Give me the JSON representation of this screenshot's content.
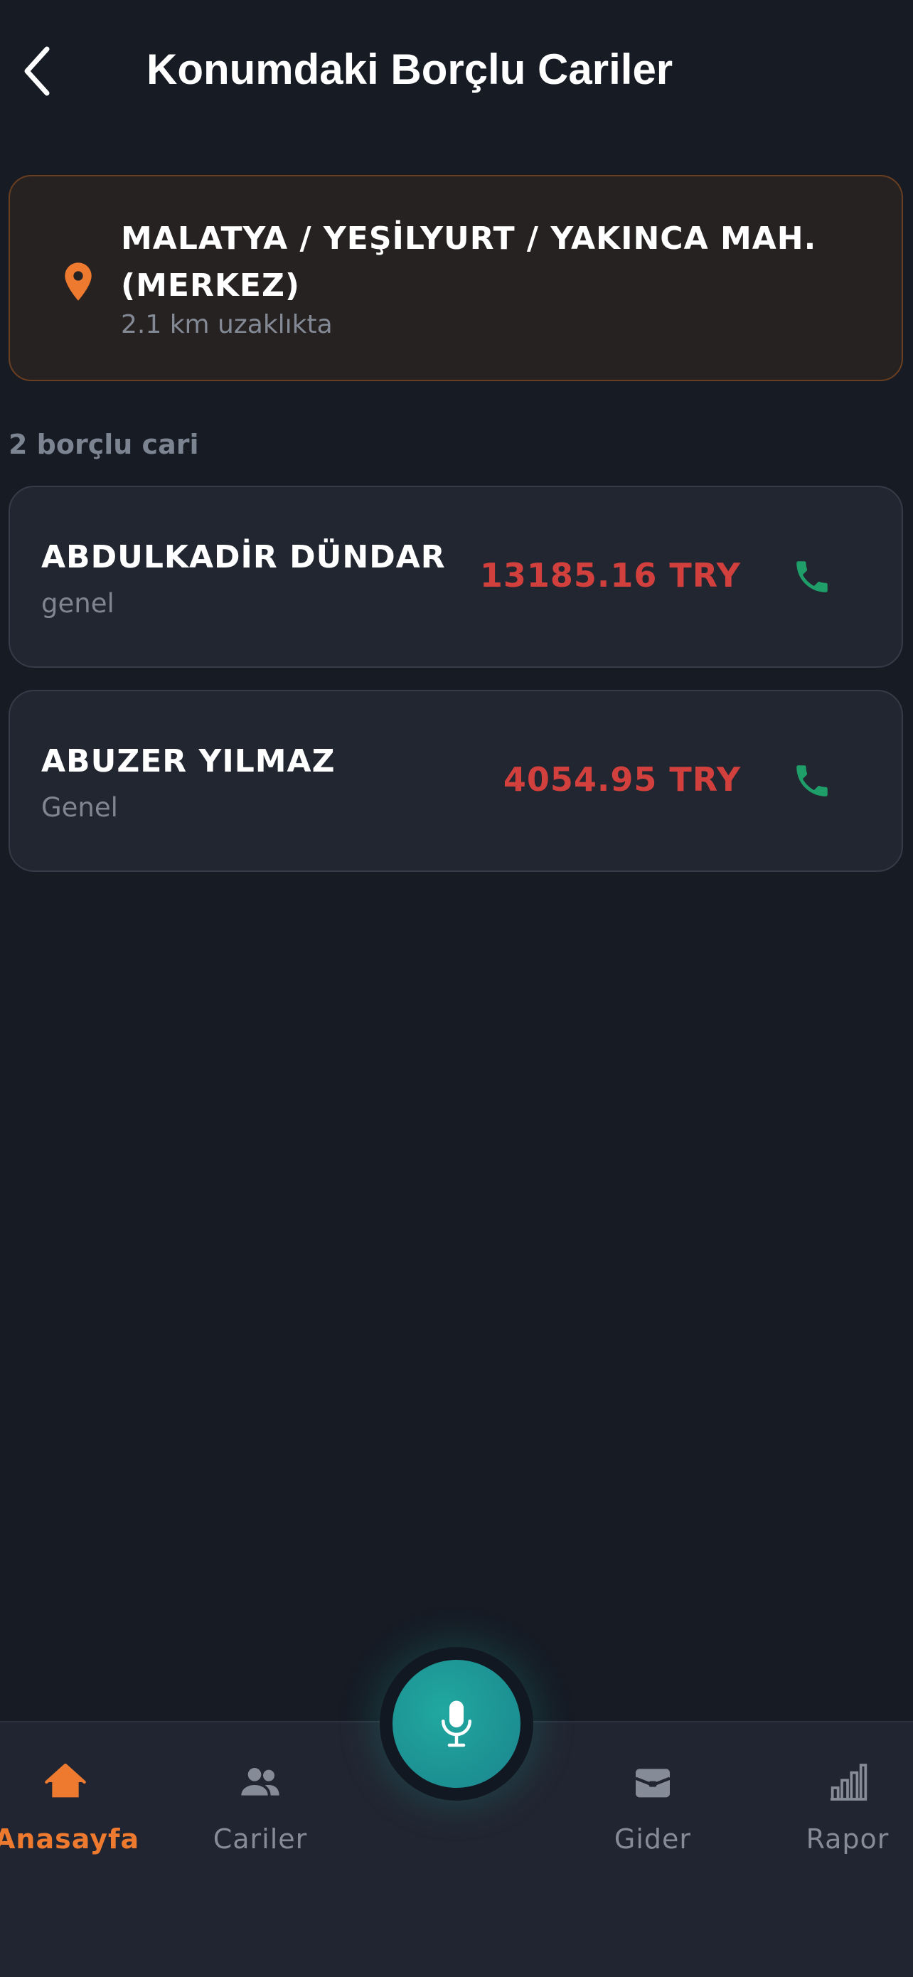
{
  "header": {
    "title": "Konumdaki Borçlu Cariler",
    "back_icon": "chevron-left-icon"
  },
  "location": {
    "icon": "map-pin-icon",
    "title": "MALATYA / YEŞİLYURT / YAKINCA MAH. (MERKEZ)",
    "distance": "2.1 km uzaklıkta",
    "accent_color": "#ee7a2f"
  },
  "list": {
    "count_label": "2 borçlu cari",
    "debtors": [
      {
        "name": "ABDULKADİR DÜNDAR",
        "group": "genel",
        "amount": "13185.16 TRY"
      },
      {
        "name": "ABUZER YILMAZ",
        "group": "Genel",
        "amount": "4054.95 TRY"
      }
    ],
    "amount_color": "#d2403e",
    "call_icon_color": "#1f9e6a"
  },
  "nav": {
    "items": [
      {
        "label": "Anasayfa",
        "icon": "home-icon",
        "active": true
      },
      {
        "label": "Cariler",
        "icon": "users-icon",
        "active": false
      },
      {
        "label": "Gider",
        "icon": "wallet-icon",
        "active": false
      },
      {
        "label": "Rapor",
        "icon": "bar-chart-icon",
        "active": false
      }
    ],
    "mic_icon": "microphone-icon",
    "active_color": "#ee7a2f"
  }
}
